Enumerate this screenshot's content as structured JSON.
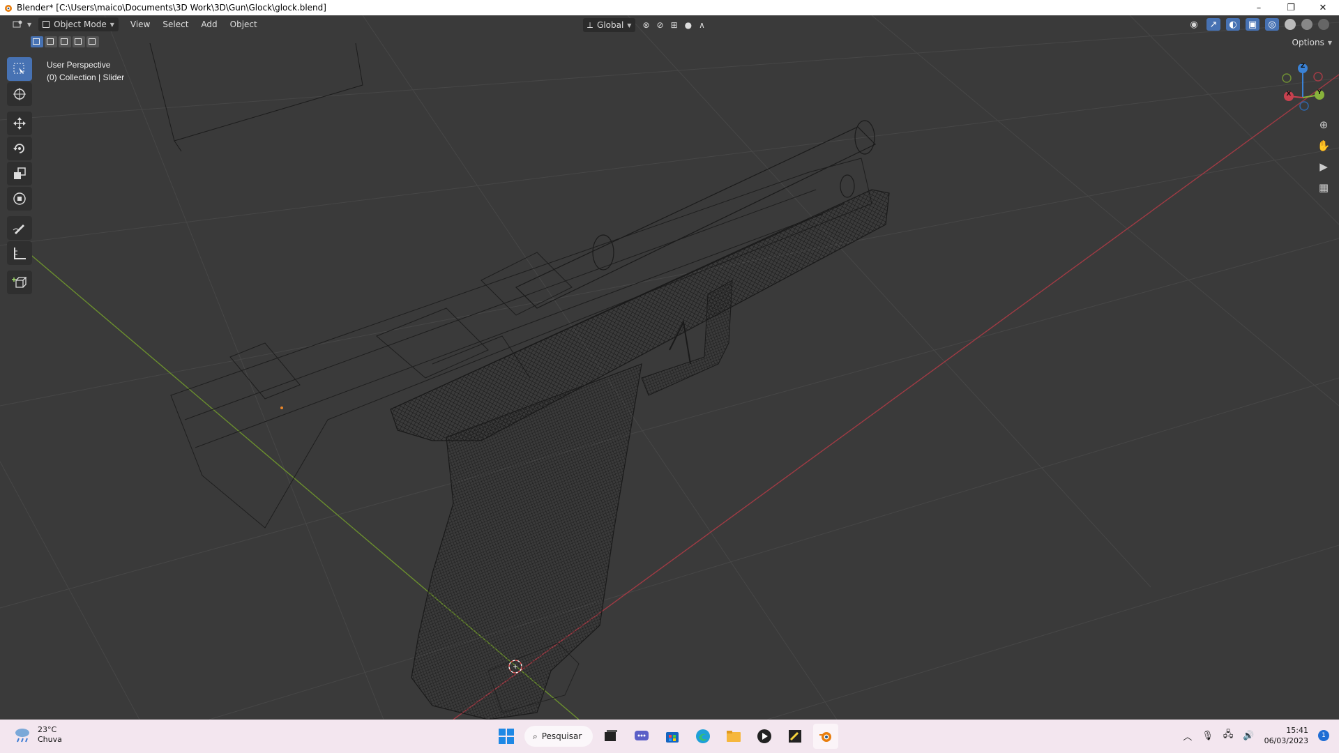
{
  "window": {
    "title": "Blender* [C:\\Users\\maico\\Documents\\3D Work\\3D\\Gun\\Glock\\glock.blend]",
    "controls": [
      "–",
      "❐",
      "✕"
    ]
  },
  "header": {
    "mode_label": "Object Mode",
    "menus": [
      "View",
      "Select",
      "Add",
      "Object"
    ],
    "transform_orientation": "Global",
    "options_label": "Options"
  },
  "viewport": {
    "view_name": "User Perspective",
    "collection_info": "(0) Collection | Slider",
    "gizmo_axes": {
      "x": "X",
      "y": "Y",
      "z": "Z"
    },
    "axis_colors": {
      "x": "#c8414f",
      "y": "#88b33b",
      "z": "#3a82d6",
      "grid": "#4a4a4a"
    }
  },
  "toolbar": {
    "tools": [
      "select-box",
      "cursor",
      "move",
      "rotate",
      "scale",
      "transform",
      "annotate",
      "measure",
      "add-cube"
    ],
    "active_tool": "select-box"
  },
  "taskbar": {
    "weather_temp": "23°C",
    "weather_desc": "Chuva",
    "search_label": "Pesquisar",
    "time": "15:41",
    "date": "06/03/2023",
    "notification_count": "1"
  }
}
